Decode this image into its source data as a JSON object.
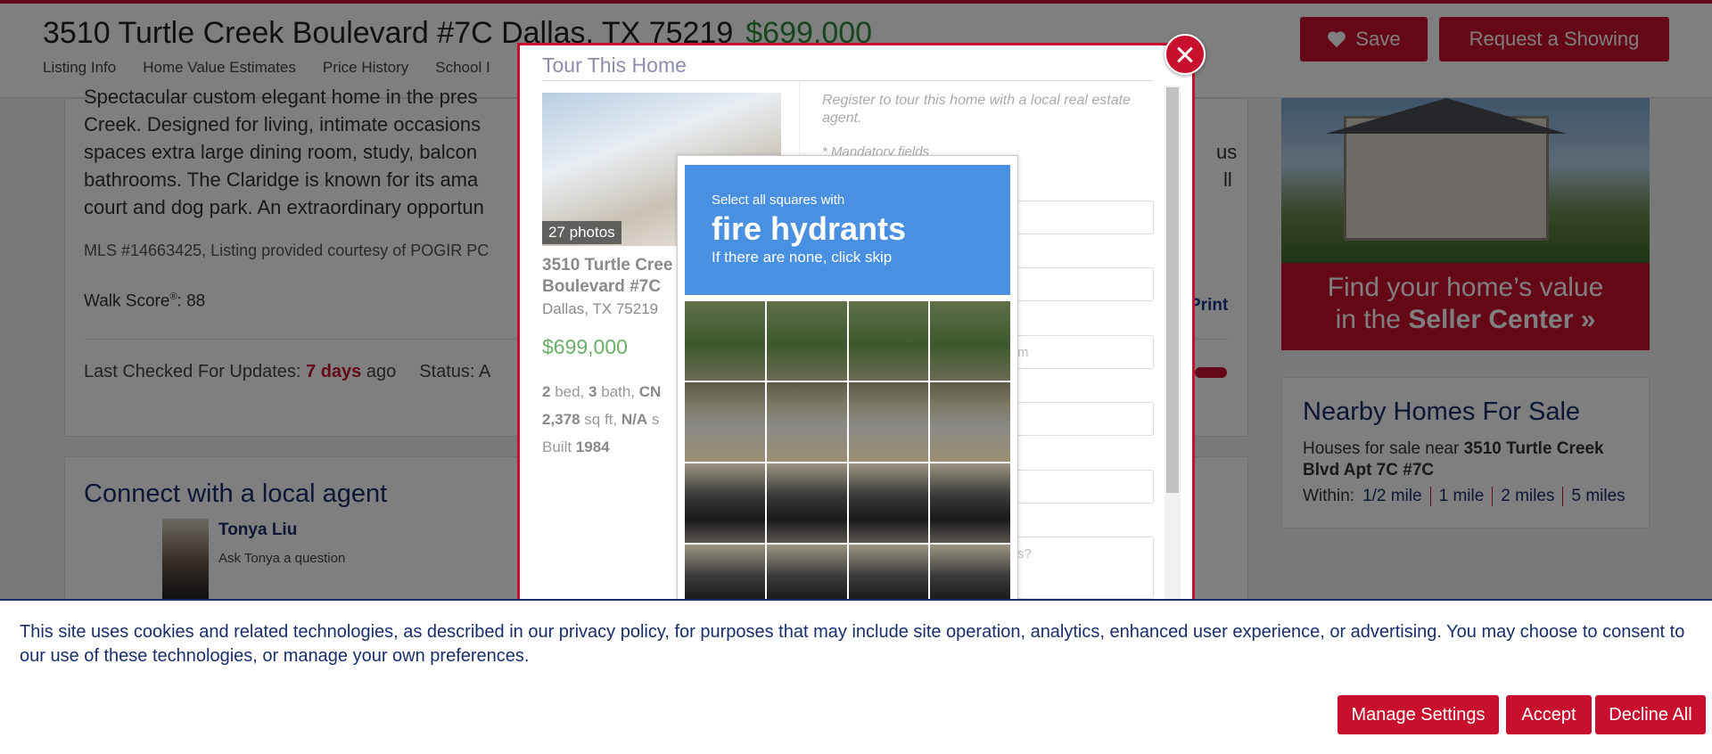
{
  "header": {
    "address": "3510 Turtle Creek Boulevard #7C Dallas, TX 75219",
    "price": "$699,000",
    "nav": [
      "Listing Info",
      "Home Value Estimates",
      "Price History",
      "School I"
    ],
    "save_label": "Save",
    "request_label": "Request a Showing"
  },
  "listing": {
    "description_lines": [
      "Spectacular custom elegant home in the pres",
      "Creek. Designed for living, intimate occasions",
      "spaces extra large dining room, study, balcon",
      "bathrooms. The Claridge is known for its ama",
      "court and dog park. An extraordinary opportun"
    ],
    "desc_right_fragments": [
      "us",
      "ll"
    ],
    "mls": "MLS #14663425, Listing provided courtesy of POGIR PC",
    "walk_label": "Walk Score",
    "walk_sup": "®",
    "walk_value": ": 88",
    "print": "Print",
    "checked_label": "Last Checked For Updates:",
    "checked_days": "7 days",
    "checked_suffix": "ago",
    "status_label": "Status: A"
  },
  "agent": {
    "heading": "Connect with a local agent",
    "name": "Tonya Liu",
    "ask": "Ask Tonya a question"
  },
  "ad": {
    "line1": "Find your home’s value",
    "line2_prefix": "in the ",
    "line2_bold": "Seller Center »"
  },
  "nearby": {
    "heading": "Nearby Homes For Sale",
    "text_prefix": "Houses for sale near ",
    "text_bold": "3510 Turtle Creek Blvd Apt 7C #7C",
    "within_label": "Within:",
    "distances": [
      "1/2 mile",
      "1 mile",
      "2 miles",
      "5 miles"
    ]
  },
  "modal": {
    "title": "Tour This Home",
    "photo_count": "27 photos",
    "street": "3510 Turtle Cree Boulevard #7C",
    "city": "Dallas, TX 75219",
    "price": "$699,000",
    "facts_line1": {
      "bed_n": "2",
      "bed": " bed, ",
      "bath_n": "3",
      "bath": " bath, ",
      "cn": "CN"
    },
    "facts_line2": {
      "sqft_n": "2,378",
      "sqft": " sq ft, ",
      "na": "N/A",
      "s": " s"
    },
    "facts_line3": {
      "built": "Built ",
      "year": "1984"
    },
    "register": "Register to tour this home with a local real estate agent.",
    "mandatory": "* Mandatory fields",
    "field_placeholder_3": "m",
    "field_placeholder_6": "s?"
  },
  "captcha": {
    "instruction": "Select all squares with",
    "target": "fire hydrants",
    "hint": "If there are none, click skip"
  },
  "cookie": {
    "text": "This site uses cookies and related technologies, as described in our privacy policy, for purposes that may include site operation, analytics, enhanced user experience, or advertising. You may choose to consent to our use of these technologies, or manage your own preferences.",
    "manage": "Manage Settings",
    "accept": "Accept",
    "decline": "Decline All"
  },
  "icons": {
    "save": "heart-icon",
    "close": "close-icon"
  },
  "colors": {
    "brand_red": "#c8102e",
    "navy": "#1a2e6b",
    "price_green": "#2e8b3a",
    "captcha_blue": "#4a90e2"
  }
}
